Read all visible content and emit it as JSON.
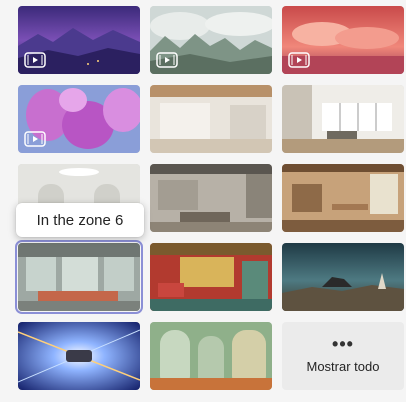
{
  "backgrounds": {
    "tiles": [
      {
        "name": "purple-mountains",
        "type": "video"
      },
      {
        "name": "misty-trees",
        "type": "video"
      },
      {
        "name": "pink-clouds",
        "type": "video"
      },
      {
        "name": "pink-flowers",
        "type": "video"
      },
      {
        "name": "white-loft",
        "type": "image"
      },
      {
        "name": "bright-living-room",
        "type": "image"
      },
      {
        "name": "white-arched-room",
        "type": "image"
      },
      {
        "name": "concrete-lounge",
        "type": "image"
      },
      {
        "name": "wood-dining-room",
        "type": "image"
      },
      {
        "name": "in-the-zone-6",
        "type": "image"
      },
      {
        "name": "colorful-room",
        "type": "image"
      },
      {
        "name": "desert-fantasy",
        "type": "image"
      },
      {
        "name": "space-warp",
        "type": "image"
      },
      {
        "name": "green-arches",
        "type": "image"
      }
    ],
    "selected_index": 9,
    "tooltip": "In the zone 6",
    "more": {
      "dots": "•••",
      "label": "Mostrar todo"
    }
  },
  "colors": {
    "selection_outline": "#8b8fd6"
  }
}
